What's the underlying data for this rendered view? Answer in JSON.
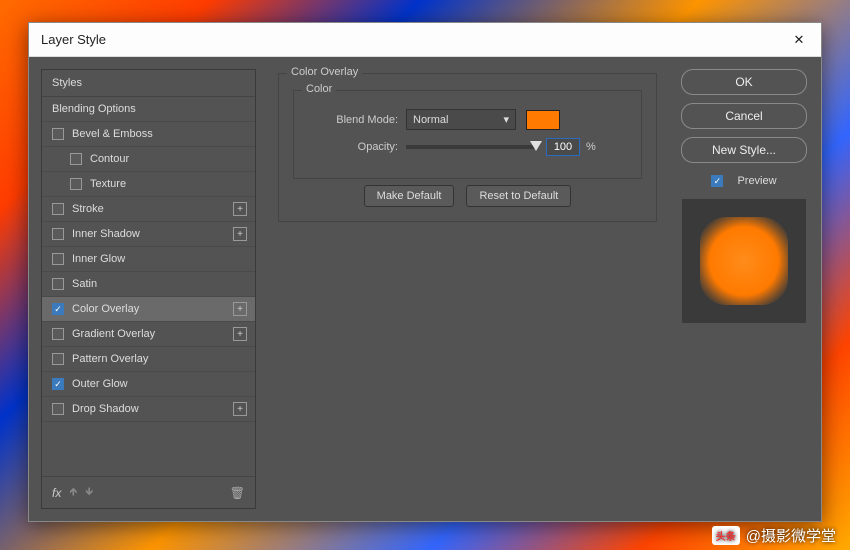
{
  "window": {
    "title": "Layer Style"
  },
  "styles": {
    "header": "Styles",
    "blending": "Blending Options",
    "items": [
      {
        "label": "Bevel & Emboss",
        "checked": false,
        "plus": false,
        "indent": false
      },
      {
        "label": "Contour",
        "checked": false,
        "plus": false,
        "indent": true
      },
      {
        "label": "Texture",
        "checked": false,
        "plus": false,
        "indent": true
      },
      {
        "label": "Stroke",
        "checked": false,
        "plus": true,
        "indent": false
      },
      {
        "label": "Inner Shadow",
        "checked": false,
        "plus": true,
        "indent": false
      },
      {
        "label": "Inner Glow",
        "checked": false,
        "plus": false,
        "indent": false
      },
      {
        "label": "Satin",
        "checked": false,
        "plus": false,
        "indent": false
      },
      {
        "label": "Color Overlay",
        "checked": true,
        "plus": true,
        "indent": false,
        "selected": true
      },
      {
        "label": "Gradient Overlay",
        "checked": false,
        "plus": true,
        "indent": false
      },
      {
        "label": "Pattern Overlay",
        "checked": false,
        "plus": false,
        "indent": false
      },
      {
        "label": "Outer Glow",
        "checked": true,
        "plus": false,
        "indent": false
      },
      {
        "label": "Drop Shadow",
        "checked": false,
        "plus": true,
        "indent": false
      }
    ],
    "fx": "fx"
  },
  "overlay": {
    "title": "Color Overlay",
    "color_label": "Color",
    "blend_label": "Blend Mode:",
    "blend_value": "Normal",
    "swatch_color": "#ff7a00",
    "opacity_label": "Opacity:",
    "opacity_value": "100",
    "opacity_unit": "%",
    "make_default": "Make Default",
    "reset_default": "Reset to Default"
  },
  "right": {
    "ok": "OK",
    "cancel": "Cancel",
    "new_style": "New Style...",
    "preview": "Preview",
    "preview_checked": true
  },
  "watermark": {
    "badge": "头条",
    "text": "@摄影微学堂"
  }
}
